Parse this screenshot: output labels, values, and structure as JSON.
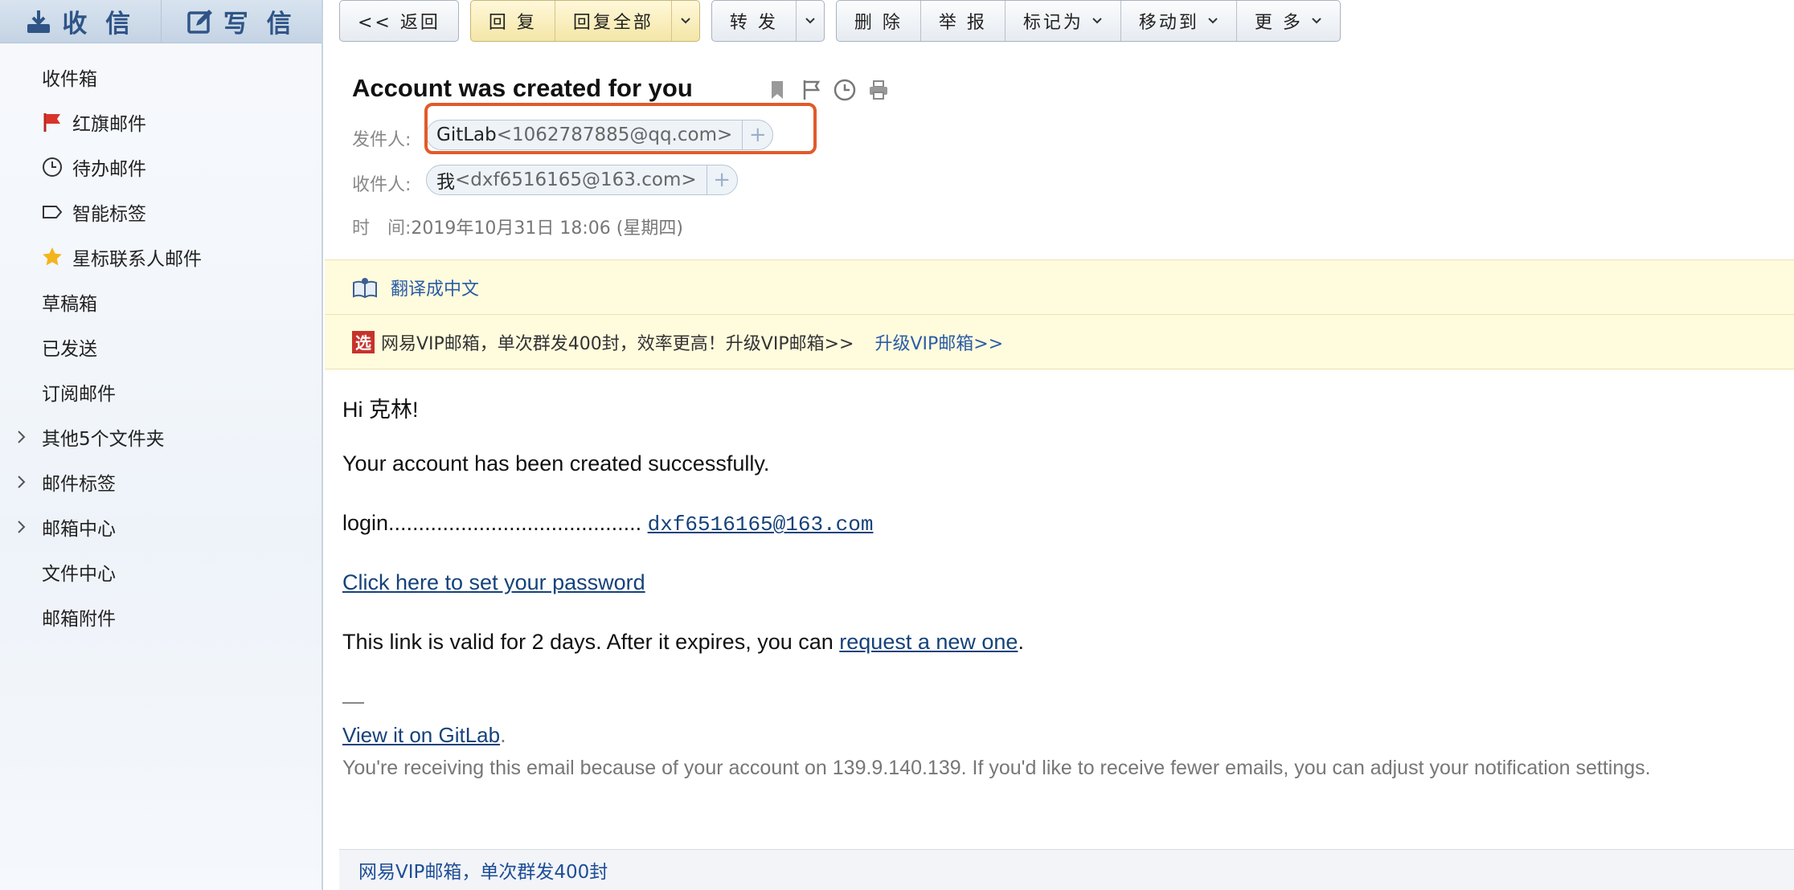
{
  "sidebar": {
    "receive_label": "收 信",
    "compose_label": "写 信",
    "folders": [
      {
        "label": "收件箱",
        "icon": "none"
      },
      {
        "label": "红旗邮件",
        "icon": "red-flag-icon"
      },
      {
        "label": "待办邮件",
        "icon": "clock-icon"
      },
      {
        "label": "智能标签",
        "icon": "tag-icon"
      },
      {
        "label": "星标联系人邮件",
        "icon": "star-icon"
      },
      {
        "label": "草稿箱",
        "icon": "none"
      },
      {
        "label": "已发送",
        "icon": "none"
      },
      {
        "label": "订阅邮件",
        "icon": "none"
      },
      {
        "label": "其他5个文件夹",
        "icon": "chevron-right-icon"
      },
      {
        "label": "邮件标签",
        "icon": "chevron-right-icon"
      },
      {
        "label": "邮箱中心",
        "icon": "chevron-right-icon"
      },
      {
        "label": "文件中心",
        "icon": "none"
      },
      {
        "label": "邮箱附件",
        "icon": "none"
      }
    ]
  },
  "toolbar": {
    "back": "<< 返回",
    "reply": "回 复",
    "reply_all": "回复全部",
    "forward": "转 发",
    "delete": "删 除",
    "report": "举 报",
    "mark_as": "标记为",
    "move_to": "移动到",
    "more": "更 多"
  },
  "mail": {
    "subject": "Account was created for you",
    "from_label": "发件人:",
    "from_name": "GitLab",
    "from_addr": "<1062787885@qq.com>",
    "to_label": "收件人:",
    "to_name": "我",
    "to_addr": "<dxf6516165@163.com>",
    "time_label": "时　间:",
    "time_value": "2019年10月31日 18:06 (星期四)",
    "add_symbol": "+"
  },
  "notices": {
    "translate": "翻译成中文",
    "vip_badge": "选",
    "vip_text": "网易VIP邮箱，单次群发400封，效率更高！升级VIP邮箱>>",
    "vip_link": "升级VIP邮箱>>"
  },
  "body": {
    "greeting": "Hi 克林!",
    "line1": "Your account has been created successfully.",
    "login_prefix": "login..........................................",
    "login_value": "dxf6516165@163.com",
    "set_password_link": "Click here to set your password",
    "valid_text": "This link is valid for 2 days. After it expires, you can",
    "request_link": "request a new one",
    "period": ".",
    "dash": "—",
    "view_link": "View it on GitLab",
    "footer_note": "You're receiving this email because of your account on 139.9.140.139. If you'd like to receive fewer emails, you can adjust your notification settings."
  },
  "footer": {
    "ad_text": "网易VIP邮箱，单次群发400封"
  },
  "colors": {
    "highlight": "#e15a2a",
    "link": "#15427a",
    "accent": "#2f5586"
  }
}
